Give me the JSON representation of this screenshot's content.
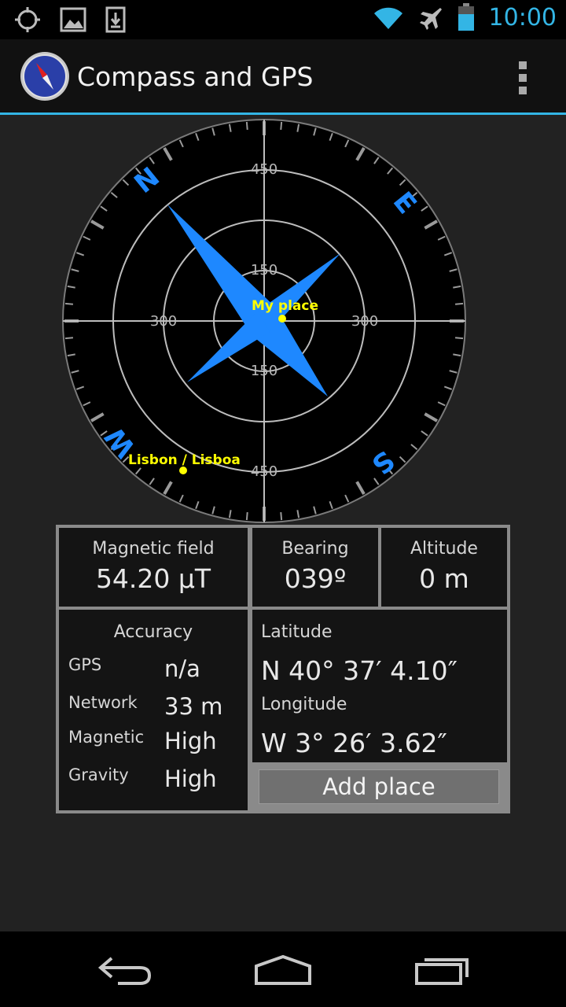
{
  "status_bar": {
    "time": "10:00",
    "left_icons": [
      "location-target-icon",
      "image-icon",
      "download-icon"
    ],
    "right_icons": [
      "wifi-icon",
      "airplane-icon",
      "battery-icon"
    ],
    "accent": "#33b5e5"
  },
  "action_bar": {
    "title": "Compass and GPS",
    "icon": "compass-app-icon",
    "menu_icon": "overflow-menu-icon"
  },
  "compass": {
    "ring_labels": [
      "450",
      "150",
      "300",
      "300",
      "150",
      "450"
    ],
    "directions": [
      "N",
      "E",
      "S",
      "W"
    ],
    "places": [
      "My place",
      "Lisbon / Lisboa"
    ],
    "needle_color": "#1e88ff",
    "place_color": "#ffff00"
  },
  "info": {
    "magnetic_field": {
      "label": "Magnetic field",
      "value": "54.20 µT"
    },
    "bearing": {
      "label": "Bearing",
      "value": "039º"
    },
    "altitude": {
      "label": "Altitude",
      "value": "0 m"
    },
    "accuracy": {
      "title": "Accuracy",
      "rows": [
        {
          "label": "GPS",
          "value": "n/a"
        },
        {
          "label": "Network",
          "value": "33 m"
        },
        {
          "label": "Magnetic",
          "value": "High"
        },
        {
          "label": "Gravity",
          "value": "High"
        }
      ]
    },
    "latitude": {
      "label": "Latitude",
      "value": "N 40° 37′ 4.10″"
    },
    "longitude": {
      "label": "Longitude",
      "value": "W 3° 26′ 3.62″"
    },
    "add_place_label": "Add place"
  },
  "nav_bar": {
    "buttons": [
      "back-icon",
      "home-icon",
      "recent-apps-icon"
    ]
  }
}
